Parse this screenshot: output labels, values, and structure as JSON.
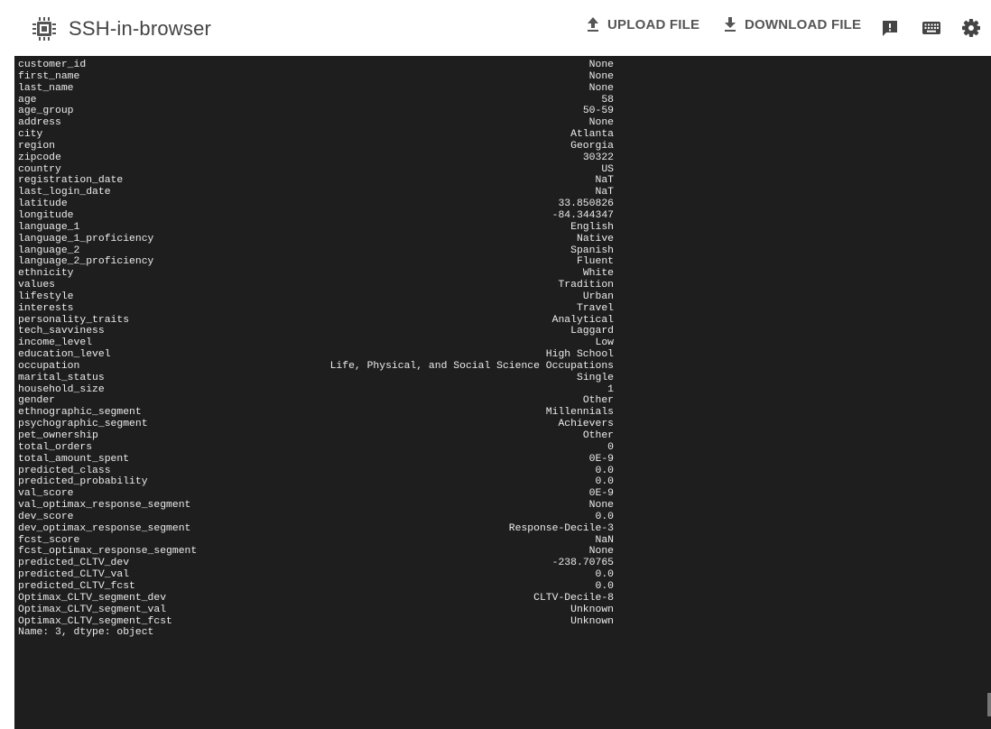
{
  "header": {
    "title": "SSH-in-browser",
    "upload_label": "UPLOAD FILE",
    "download_label": "DOWNLOAD FILE",
    "icons": {
      "logo": "chip-icon",
      "upload": "upload-icon",
      "download": "download-icon",
      "feedback": "feedback-icon",
      "keyboard": "keyboard-icon",
      "settings": "gear-icon"
    }
  },
  "terminal": {
    "rows": [
      {
        "key": "customer_id",
        "value": "None"
      },
      {
        "key": "first_name",
        "value": "None"
      },
      {
        "key": "last_name",
        "value": "None"
      },
      {
        "key": "age",
        "value": "58"
      },
      {
        "key": "age_group",
        "value": "50-59"
      },
      {
        "key": "address",
        "value": "None"
      },
      {
        "key": "city",
        "value": "Atlanta"
      },
      {
        "key": "region",
        "value": "Georgia"
      },
      {
        "key": "zipcode",
        "value": "30322"
      },
      {
        "key": "country",
        "value": "US"
      },
      {
        "key": "registration_date",
        "value": "NaT"
      },
      {
        "key": "last_login_date",
        "value": "NaT"
      },
      {
        "key": "latitude",
        "value": "33.850826"
      },
      {
        "key": "longitude",
        "value": "-84.344347"
      },
      {
        "key": "language_1",
        "value": "English"
      },
      {
        "key": "language_1_proficiency",
        "value": "Native"
      },
      {
        "key": "language_2",
        "value": "Spanish"
      },
      {
        "key": "language_2_proficiency",
        "value": "Fluent"
      },
      {
        "key": "ethnicity",
        "value": "White"
      },
      {
        "key": "values",
        "value": "Tradition"
      },
      {
        "key": "lifestyle",
        "value": "Urban"
      },
      {
        "key": "interests",
        "value": "Travel"
      },
      {
        "key": "personality_traits",
        "value": "Analytical"
      },
      {
        "key": "tech_savviness",
        "value": "Laggard"
      },
      {
        "key": "income_level",
        "value": "Low"
      },
      {
        "key": "education_level",
        "value": "High School"
      },
      {
        "key": "occupation",
        "value": "Life, Physical, and Social Science Occupations"
      },
      {
        "key": "marital_status",
        "value": "Single"
      },
      {
        "key": "household_size",
        "value": "1"
      },
      {
        "key": "gender",
        "value": "Other"
      },
      {
        "key": "ethnographic_segment",
        "value": "Millennials"
      },
      {
        "key": "psychographic_segment",
        "value": "Achievers"
      },
      {
        "key": "pet_ownership",
        "value": "Other"
      },
      {
        "key": "total_orders",
        "value": "0"
      },
      {
        "key": "total_amount_spent",
        "value": "0E-9"
      },
      {
        "key": "predicted_class",
        "value": "0.0"
      },
      {
        "key": "predicted_probability",
        "value": "0.0"
      },
      {
        "key": "val_score",
        "value": "0E-9"
      },
      {
        "key": "val_optimax_response_segment",
        "value": "None"
      },
      {
        "key": "dev_score",
        "value": "0.0"
      },
      {
        "key": "dev_optimax_response_segment",
        "value": "Response-Decile-3"
      },
      {
        "key": "fcst_score",
        "value": "NaN"
      },
      {
        "key": "fcst_optimax_response_segment",
        "value": "None"
      },
      {
        "key": "predicted_CLTV_dev",
        "value": "-238.70765"
      },
      {
        "key": "predicted_CLTV_val",
        "value": "0.0"
      },
      {
        "key": "predicted_CLTV_fcst",
        "value": "0.0"
      },
      {
        "key": "Optimax_CLTV_segment_dev",
        "value": "CLTV-Decile-8"
      },
      {
        "key": "Optimax_CLTV_segment_val",
        "value": "Unknown"
      },
      {
        "key": "Optimax_CLTV_segment_fcst",
        "value": "Unknown"
      }
    ],
    "footer": "Name: 3, dtype: object"
  },
  "colors": {
    "terminal_bg": "#1e1e1e",
    "terminal_fg": "#ececec",
    "header_text": "#555555"
  }
}
